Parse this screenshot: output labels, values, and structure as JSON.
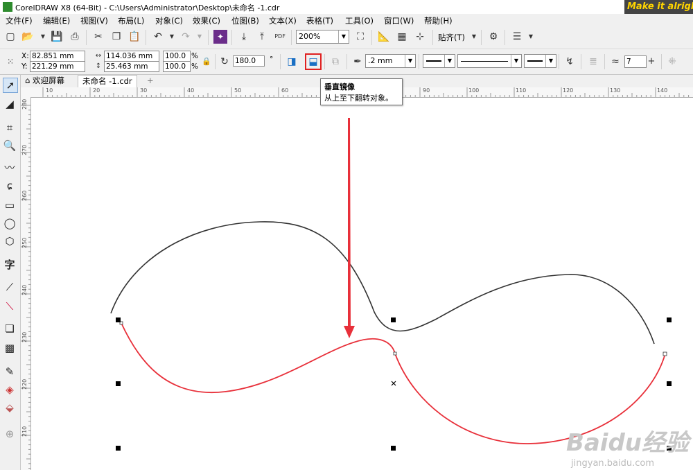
{
  "window": {
    "title": "CorelDRAW X8 (64-Bit) - C:\\Users\\Administrator\\Desktop\\未命名 -1.cdr",
    "slogan": "Make it alright"
  },
  "menu": [
    "文件(F)",
    "编辑(E)",
    "视图(V)",
    "布局(L)",
    "对象(C)",
    "效果(C)",
    "位图(B)",
    "文本(X)",
    "表格(T)",
    "工具(O)",
    "窗口(W)",
    "帮助(H)"
  ],
  "toolbar": {
    "zoom": "200%",
    "snap_label": "贴齐(T)"
  },
  "property_bar": {
    "x": "82.851 mm",
    "y": "221.29 mm",
    "x_label": "X:",
    "y_label": "Y:",
    "width": "114.036 mm",
    "height": "25.463 mm",
    "scale_w": "100.0",
    "scale_h": "100.0",
    "percent": "%",
    "rotation": "180.0",
    "degree": "°",
    "outline_width": ".2 mm",
    "nodes": "7"
  },
  "tabs": [
    {
      "label": "欢迎屏幕"
    },
    {
      "label": "未命名 -1.cdr"
    }
  ],
  "tooltip": {
    "title": "垂直镜像",
    "description": "从上至下翻转对象。"
  },
  "ruler_h": [
    "10",
    "20",
    "30",
    "40",
    "50",
    "60",
    "70",
    "80",
    "90",
    "100",
    "110",
    "120",
    "130",
    "140"
  ],
  "ruler_v": [
    "280",
    "270",
    "260",
    "250",
    "240",
    "230",
    "220",
    "210"
  ],
  "colors": {
    "accent_red": "#e8303a",
    "curve_black": "#333333",
    "highlight": "#e02020"
  },
  "watermark": {
    "brand": "Baidu经验",
    "url": "jingyan.baidu.com"
  }
}
